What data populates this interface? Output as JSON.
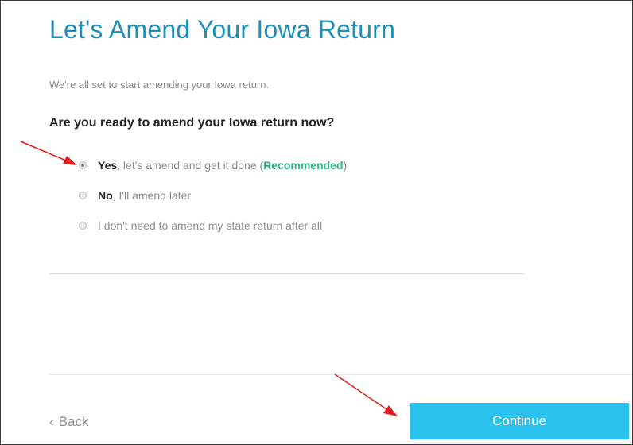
{
  "page": {
    "title": "Let's Amend Your Iowa Return",
    "subtitle": "We're all set to start amending your Iowa return.",
    "question": "Are you ready to amend your Iowa return now?"
  },
  "options": [
    {
      "strong": "Yes",
      "text": ", let's amend and get it done (",
      "recommended": "Recommended",
      "suffix": ")",
      "selected": true
    },
    {
      "strong": "No",
      "text": ", I'll amend later",
      "selected": false
    },
    {
      "strong": "",
      "text": "I don't need to amend my state return after all",
      "selected": false
    }
  ],
  "footer": {
    "back_label": "Back",
    "back_icon": "chevron-left-icon",
    "continue_label": "Continue"
  },
  "colors": {
    "title": "#1e8fb8",
    "recommended": "#2db37e",
    "continue_button": "#29c1ee",
    "annotation_arrow": "#e0201e"
  }
}
